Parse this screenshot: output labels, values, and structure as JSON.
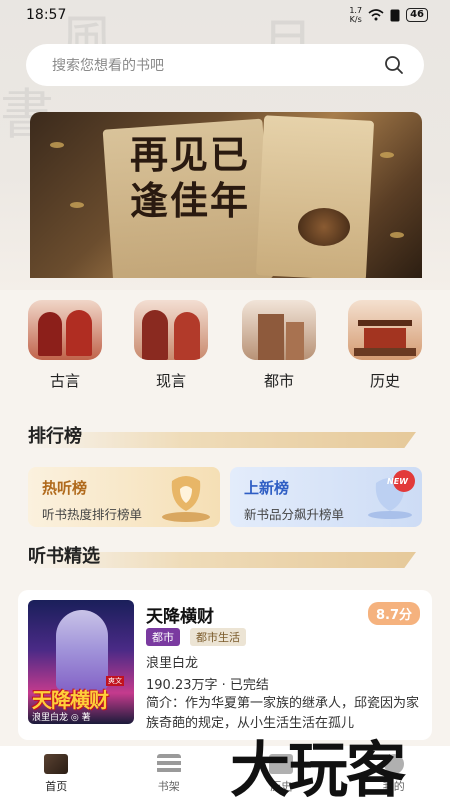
{
  "status_bar": {
    "time": "18:57",
    "net_speed": "1.7\nK/s",
    "battery": "46"
  },
  "search": {
    "placeholder": "搜索您想看的书吧"
  },
  "banner": {
    "title": "再见已逢佳年"
  },
  "categories": [
    {
      "label": "古言"
    },
    {
      "label": "现言"
    },
    {
      "label": "都市"
    },
    {
      "label": "历史"
    }
  ],
  "ranking": {
    "title": "排行榜",
    "cards": [
      {
        "title": "热听榜",
        "subtitle": "听书热度排行榜单"
      },
      {
        "title": "上新榜",
        "subtitle": "新书品分飙升榜单",
        "badge": "NEW"
      }
    ]
  },
  "featured": {
    "title": "听书精选",
    "book": {
      "title": "天降横财",
      "score": "8.7分",
      "tags": [
        "都市",
        "都市生活"
      ],
      "author": "浪里白龙",
      "meta": "190.23万字 · 已完结",
      "intro": "简介：作为华夏第一家族的继承人，邱瓷因为家族奇葩的规定，从小生活生活在孤儿",
      "cover_title": "天降横财",
      "cover_author": "浪里白龙 ◎ 著",
      "cover_badge": "爽文"
    }
  },
  "tabbar": [
    {
      "label": "首页"
    },
    {
      "label": "书架"
    },
    {
      "label": "历史"
    },
    {
      "label": "我的"
    }
  ],
  "watermark": "大玩客",
  "colors": {
    "accent": "#c7772a",
    "tag_blue_bg": "#7a3aa0",
    "score_bg": "#f5b27e"
  }
}
